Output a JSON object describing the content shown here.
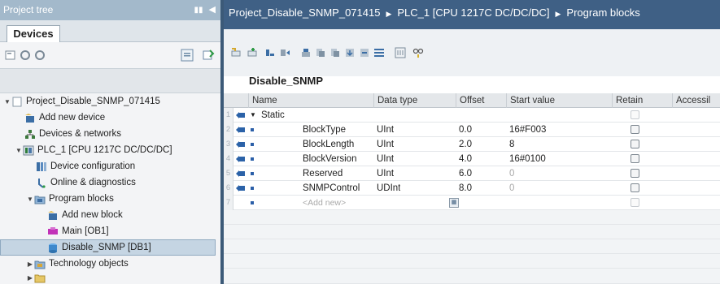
{
  "left_panel": {
    "title": "Project tree",
    "tab_label": "Devices",
    "tree": [
      {
        "label": "Project_Disable_SNMP_071415",
        "indent": 0,
        "expand": "▼",
        "icon": "project-icon"
      },
      {
        "label": "Add new device",
        "indent": 1,
        "expand": "",
        "icon": "add-device-icon"
      },
      {
        "label": "Devices & networks",
        "indent": 1,
        "expand": "",
        "icon": "network-icon"
      },
      {
        "label": "PLC_1 [CPU 1217C DC/DC/DC]",
        "indent": 1,
        "expand": "▼",
        "icon": "plc-icon"
      },
      {
        "label": "Device configuration",
        "indent": 2,
        "expand": "",
        "icon": "device-config-icon"
      },
      {
        "label": "Online & diagnostics",
        "indent": 2,
        "expand": "",
        "icon": "diagnostics-icon"
      },
      {
        "label": "Program blocks",
        "indent": 2,
        "expand": "▼",
        "icon": "folder-icon"
      },
      {
        "label": "Add new block",
        "indent": 3,
        "expand": "",
        "icon": "add-block-icon"
      },
      {
        "label": "Main [OB1]",
        "indent": 3,
        "expand": "",
        "icon": "ob-icon"
      },
      {
        "label": "Disable_SNMP [DB1]",
        "indent": 3,
        "expand": "",
        "icon": "db-icon",
        "selected": true
      },
      {
        "label": "Technology objects",
        "indent": 2,
        "expand": "▶",
        "icon": "tech-folder-icon"
      }
    ]
  },
  "breadcrumb": {
    "items": [
      "Project_Disable_SNMP_071415",
      "PLC_1 [CPU 1217C DC/DC/DC]",
      "Program blocks"
    ],
    "separator": "▶"
  },
  "editor": {
    "block_name": "Disable_SNMP",
    "columns": [
      "Name",
      "Data type",
      "Offset",
      "Start value",
      "Retain",
      "Accessil"
    ],
    "rows": [
      {
        "num": "1",
        "name": "Static",
        "type": "",
        "offset": "",
        "start": "",
        "expand": true
      },
      {
        "num": "2",
        "name": "BlockType",
        "type": "UInt",
        "offset": "0.0",
        "start": "16#F003"
      },
      {
        "num": "3",
        "name": "BlockLength",
        "type": "UInt",
        "offset": "2.0",
        "start": "8"
      },
      {
        "num": "4",
        "name": "BlockVersion",
        "type": "UInt",
        "offset": "4.0",
        "start": "16#0100"
      },
      {
        "num": "5",
        "name": "Reserved",
        "type": "UInt",
        "offset": "6.0",
        "start": "0"
      },
      {
        "num": "6",
        "name": "SNMPControl",
        "type": "UDInt",
        "offset": "8.0",
        "start": "0"
      },
      {
        "num": "7",
        "name": "<Add new>",
        "type": "",
        "offset": "",
        "start": "",
        "placeholder": true
      }
    ]
  },
  "colors": {
    "breadcrumb_bg": "#3f6085",
    "left_header_bg": "#a3b9cb",
    "divider": "#3c5a78",
    "selection_bg": "#c5d5e3"
  }
}
